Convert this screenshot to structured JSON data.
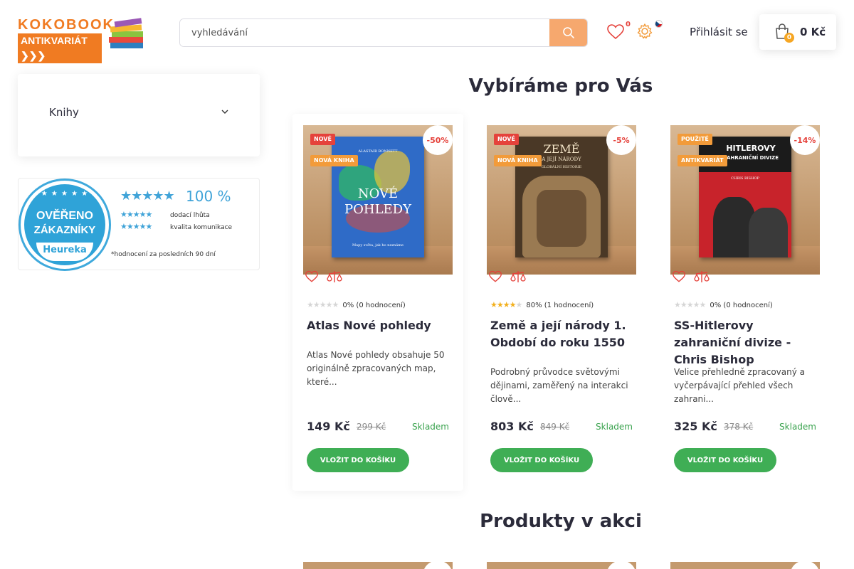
{
  "header": {
    "logo_line1": "KOKOBOOK",
    "logo_line2": "ANTIKVARIÁT",
    "search_placeholder": "vyhledávání",
    "wishlist_count": "0",
    "login_label": "Přihlásit se",
    "cart_count": "0",
    "cart_total": "0 Kč"
  },
  "sidebar": {
    "menu_item": "Knihy",
    "heureka": {
      "badge_line1": "OVĚŘENO",
      "badge_line2": "ZÁKAZNÍKY",
      "badge_brand": "Heureka",
      "score": "100 %",
      "rows": [
        "dodací lhůta",
        "kvalita komunikace"
      ],
      "note": "*hodnocení za posledních 90 dní"
    }
  },
  "sections": {
    "recommended_title": "Vybíráme pro Vás",
    "sale_title": "Produkty v akci"
  },
  "products": [
    {
      "tag1": "NOVÉ",
      "tag2": "NOVÁ KNIHA",
      "discount": "-50%",
      "rating": "0% (0 hodnocení)",
      "rating_fraction": 0,
      "title": "Atlas Nové pohledy",
      "description": "Atlas Nové pohledy obsahuje 50 originálně zpracovaných map, které...",
      "price": "149 Kč",
      "old_price": "299 Kč",
      "stock": "Skladem",
      "button": "VLOŽIT DO KOŠÍKU",
      "cover_author": "ALASTAIR BONNETT",
      "cover_title1": "NOVÉ",
      "cover_title2": "POHLEDY",
      "cover_sub": "Mapy světa, jak ho neznáme"
    },
    {
      "tag1": "NOVÉ",
      "tag2": "NOVÁ KNIHA",
      "discount": "-5%",
      "rating": "80% (1 hodnocení)",
      "rating_fraction": 0.8,
      "title": "Země a její národy 1. Období do roku 1550",
      "description": "Podrobný průvodce světovými dějinami, zaměřený na interakci člově...",
      "price": "803 Kč",
      "old_price": "849 Kč",
      "stock": "Skladem",
      "button": "VLOŽIT DO KOŠÍKU",
      "cover_title1": "ZEMĚ",
      "cover_title2": "A JEJÍ NÁRODY",
      "cover_sub": "GLOBÁLNÍ HISTORIE"
    },
    {
      "tag1": "POUŽITÉ",
      "tag2": "ANTIKVARIÁT",
      "discount": "-14%",
      "rating": "0% (0 hodnocení)",
      "rating_fraction": 0,
      "title": "SS-Hitlerovy zahraniční divize - Chris Bishop",
      "description": "Velice přehledně zpracovaný a vyčerpávající přehled všech zahrani...",
      "price": "325 Kč",
      "old_price": "378 Kč",
      "stock": "Skladem",
      "button": "VLOŽIT DO KOŠÍKU",
      "cover_title1": "HITLEROVY",
      "cover_title2": "ZAHRANIČNÍ DIVIZE",
      "cover_sub": "CHRIS BISHOP"
    }
  ],
  "colors": {
    "accent_orange": "#f07b22",
    "search_button": "#f6a86e",
    "add_button": "#3fae55",
    "stock_green": "#39a24d",
    "tag_red": "#e5423b",
    "tag_orange": "#f29b3a",
    "heureka_blue": "#2fa3d8"
  },
  "icons": [
    "search-icon",
    "heart-icon",
    "gear-icon",
    "cz-flag-icon",
    "cart-icon",
    "chevron-down-icon",
    "compare-scales-icon"
  ]
}
